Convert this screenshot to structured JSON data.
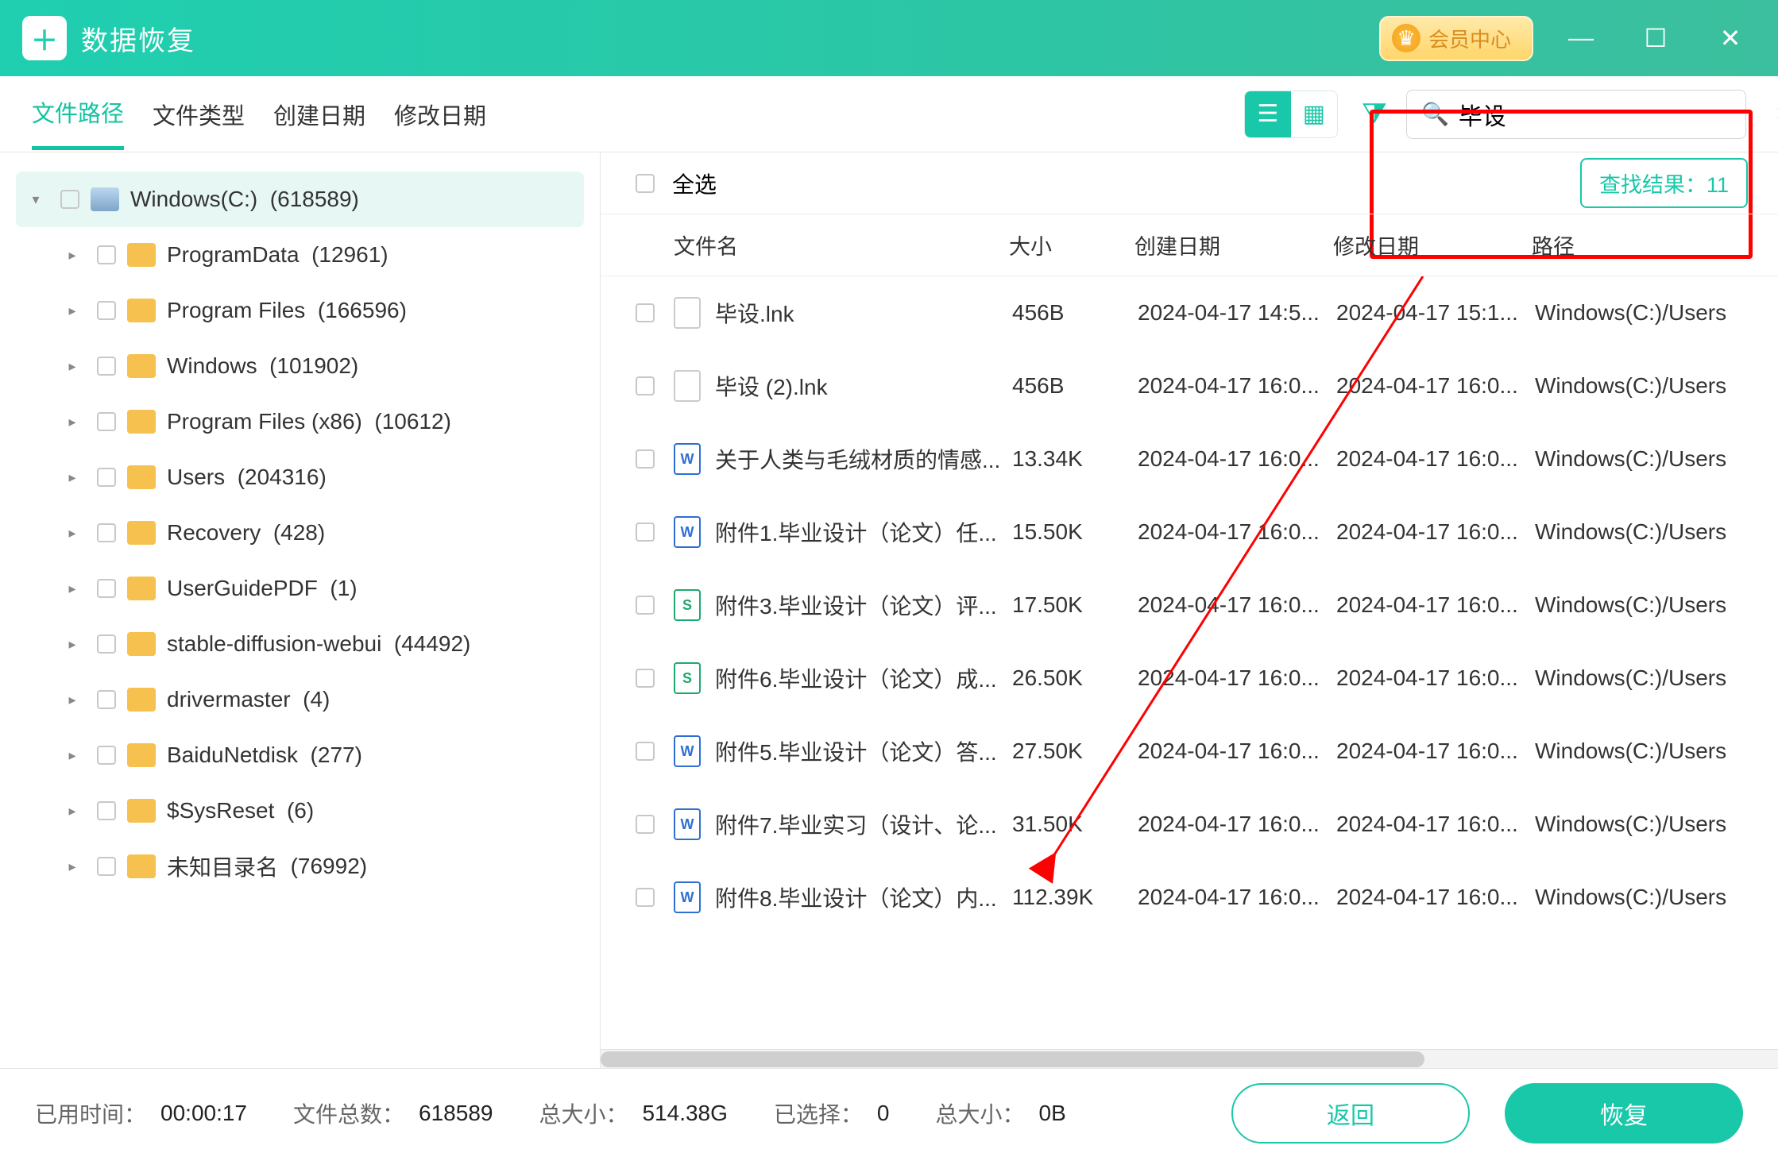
{
  "app": {
    "name": "数据恢复"
  },
  "vip": {
    "label": "会员中心"
  },
  "tabs": [
    {
      "label": "文件路径",
      "active": true
    },
    {
      "label": "文件类型",
      "active": false
    },
    {
      "label": "创建日期",
      "active": false
    },
    {
      "label": "修改日期",
      "active": false
    }
  ],
  "search": {
    "value": "毕设",
    "result_label": "查找结果：",
    "result_count": "11"
  },
  "selectall": {
    "label": "全选"
  },
  "columns": {
    "name": "文件名",
    "size": "大小",
    "cdate": "创建日期",
    "mdate": "修改日期",
    "path": "路径"
  },
  "tree": {
    "root": {
      "label": "Windows(C:)",
      "count": "(618589)"
    },
    "children": [
      {
        "label": "ProgramData",
        "count": "(12961)"
      },
      {
        "label": "Program Files",
        "count": "(166596)"
      },
      {
        "label": "Windows",
        "count": "(101902)"
      },
      {
        "label": "Program Files (x86)",
        "count": "(10612)"
      },
      {
        "label": "Users",
        "count": "(204316)"
      },
      {
        "label": "Recovery",
        "count": "(428)"
      },
      {
        "label": "UserGuidePDF",
        "count": "(1)"
      },
      {
        "label": "stable-diffusion-webui",
        "count": "(44492)"
      },
      {
        "label": "drivermaster",
        "count": "(4)"
      },
      {
        "label": "BaiduNetdisk",
        "count": "(277)"
      },
      {
        "label": "$SysReset",
        "count": "(6)"
      },
      {
        "label": "未知目录名",
        "count": "(76992)"
      }
    ]
  },
  "files": [
    {
      "icon": "",
      "name": "毕设.lnk",
      "size": "456B",
      "cdate": "2024-04-17 14:5...",
      "mdate": "2024-04-17 15:1...",
      "path": "Windows(C:)/Users"
    },
    {
      "icon": "",
      "name": "毕设 (2).lnk",
      "size": "456B",
      "cdate": "2024-04-17 16:0...",
      "mdate": "2024-04-17 16:0...",
      "path": "Windows(C:)/Users"
    },
    {
      "icon": "w",
      "name": "关于人类与毛绒材质的情感...",
      "size": "13.34K",
      "cdate": "2024-04-17 16:0...",
      "mdate": "2024-04-17 16:0...",
      "path": "Windows(C:)/Users"
    },
    {
      "icon": "w",
      "name": "附件1.毕业设计（论文）任...",
      "size": "15.50K",
      "cdate": "2024-04-17 16:0...",
      "mdate": "2024-04-17 16:0...",
      "path": "Windows(C:)/Users"
    },
    {
      "icon": "s",
      "name": "附件3.毕业设计（论文）评...",
      "size": "17.50K",
      "cdate": "2024-04-17 16:0...",
      "mdate": "2024-04-17 16:0...",
      "path": "Windows(C:)/Users"
    },
    {
      "icon": "s",
      "name": "附件6.毕业设计（论文）成...",
      "size": "26.50K",
      "cdate": "2024-04-17 16:0...",
      "mdate": "2024-04-17 16:0...",
      "path": "Windows(C:)/Users"
    },
    {
      "icon": "w",
      "name": "附件5.毕业设计（论文）答...",
      "size": "27.50K",
      "cdate": "2024-04-17 16:0...",
      "mdate": "2024-04-17 16:0...",
      "path": "Windows(C:)/Users"
    },
    {
      "icon": "w",
      "name": "附件7.毕业实习（设计、论...",
      "size": "31.50K",
      "cdate": "2024-04-17 16:0...",
      "mdate": "2024-04-17 16:0...",
      "path": "Windows(C:)/Users"
    },
    {
      "icon": "w",
      "name": "附件8.毕业设计（论文）内...",
      "size": "112.39K",
      "cdate": "2024-04-17 16:0...",
      "mdate": "2024-04-17 16:0...",
      "path": "Windows(C:)/Users"
    }
  ],
  "footer": {
    "elapsed_label": "已用时间：",
    "elapsed": "00:00:17",
    "total_label": "文件总数：",
    "total": "618589",
    "size_label": "总大小：",
    "size": "514.38G",
    "selected_label": "已选择：",
    "selected": "0",
    "selsize_label": "总大小：",
    "selsize": "0B",
    "back": "返回",
    "recover": "恢复"
  }
}
